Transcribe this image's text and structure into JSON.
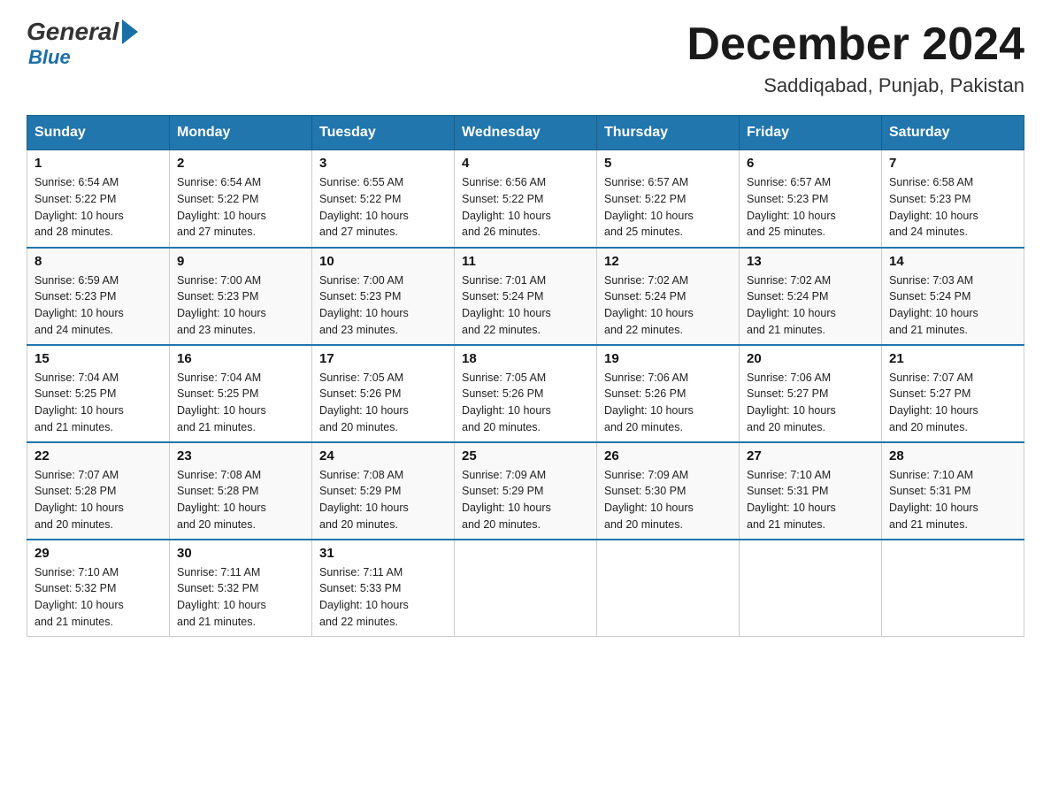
{
  "logo": {
    "general": "General",
    "blue": "Blue"
  },
  "title": "December 2024",
  "subtitle": "Saddiqabad, Punjab, Pakistan",
  "days_of_week": [
    "Sunday",
    "Monday",
    "Tuesday",
    "Wednesday",
    "Thursday",
    "Friday",
    "Saturday"
  ],
  "weeks": [
    [
      {
        "day": "1",
        "sunrise": "6:54 AM",
        "sunset": "5:22 PM",
        "daylight": "10 hours and 28 minutes."
      },
      {
        "day": "2",
        "sunrise": "6:54 AM",
        "sunset": "5:22 PM",
        "daylight": "10 hours and 27 minutes."
      },
      {
        "day": "3",
        "sunrise": "6:55 AM",
        "sunset": "5:22 PM",
        "daylight": "10 hours and 27 minutes."
      },
      {
        "day": "4",
        "sunrise": "6:56 AM",
        "sunset": "5:22 PM",
        "daylight": "10 hours and 26 minutes."
      },
      {
        "day": "5",
        "sunrise": "6:57 AM",
        "sunset": "5:22 PM",
        "daylight": "10 hours and 25 minutes."
      },
      {
        "day": "6",
        "sunrise": "6:57 AM",
        "sunset": "5:23 PM",
        "daylight": "10 hours and 25 minutes."
      },
      {
        "day": "7",
        "sunrise": "6:58 AM",
        "sunset": "5:23 PM",
        "daylight": "10 hours and 24 minutes."
      }
    ],
    [
      {
        "day": "8",
        "sunrise": "6:59 AM",
        "sunset": "5:23 PM",
        "daylight": "10 hours and 24 minutes."
      },
      {
        "day": "9",
        "sunrise": "7:00 AM",
        "sunset": "5:23 PM",
        "daylight": "10 hours and 23 minutes."
      },
      {
        "day": "10",
        "sunrise": "7:00 AM",
        "sunset": "5:23 PM",
        "daylight": "10 hours and 23 minutes."
      },
      {
        "day": "11",
        "sunrise": "7:01 AM",
        "sunset": "5:24 PM",
        "daylight": "10 hours and 22 minutes."
      },
      {
        "day": "12",
        "sunrise": "7:02 AM",
        "sunset": "5:24 PM",
        "daylight": "10 hours and 22 minutes."
      },
      {
        "day": "13",
        "sunrise": "7:02 AM",
        "sunset": "5:24 PM",
        "daylight": "10 hours and 21 minutes."
      },
      {
        "day": "14",
        "sunrise": "7:03 AM",
        "sunset": "5:24 PM",
        "daylight": "10 hours and 21 minutes."
      }
    ],
    [
      {
        "day": "15",
        "sunrise": "7:04 AM",
        "sunset": "5:25 PM",
        "daylight": "10 hours and 21 minutes."
      },
      {
        "day": "16",
        "sunrise": "7:04 AM",
        "sunset": "5:25 PM",
        "daylight": "10 hours and 21 minutes."
      },
      {
        "day": "17",
        "sunrise": "7:05 AM",
        "sunset": "5:26 PM",
        "daylight": "10 hours and 20 minutes."
      },
      {
        "day": "18",
        "sunrise": "7:05 AM",
        "sunset": "5:26 PM",
        "daylight": "10 hours and 20 minutes."
      },
      {
        "day": "19",
        "sunrise": "7:06 AM",
        "sunset": "5:26 PM",
        "daylight": "10 hours and 20 minutes."
      },
      {
        "day": "20",
        "sunrise": "7:06 AM",
        "sunset": "5:27 PM",
        "daylight": "10 hours and 20 minutes."
      },
      {
        "day": "21",
        "sunrise": "7:07 AM",
        "sunset": "5:27 PM",
        "daylight": "10 hours and 20 minutes."
      }
    ],
    [
      {
        "day": "22",
        "sunrise": "7:07 AM",
        "sunset": "5:28 PM",
        "daylight": "10 hours and 20 minutes."
      },
      {
        "day": "23",
        "sunrise": "7:08 AM",
        "sunset": "5:28 PM",
        "daylight": "10 hours and 20 minutes."
      },
      {
        "day": "24",
        "sunrise": "7:08 AM",
        "sunset": "5:29 PM",
        "daylight": "10 hours and 20 minutes."
      },
      {
        "day": "25",
        "sunrise": "7:09 AM",
        "sunset": "5:29 PM",
        "daylight": "10 hours and 20 minutes."
      },
      {
        "day": "26",
        "sunrise": "7:09 AM",
        "sunset": "5:30 PM",
        "daylight": "10 hours and 20 minutes."
      },
      {
        "day": "27",
        "sunrise": "7:10 AM",
        "sunset": "5:31 PM",
        "daylight": "10 hours and 21 minutes."
      },
      {
        "day": "28",
        "sunrise": "7:10 AM",
        "sunset": "5:31 PM",
        "daylight": "10 hours and 21 minutes."
      }
    ],
    [
      {
        "day": "29",
        "sunrise": "7:10 AM",
        "sunset": "5:32 PM",
        "daylight": "10 hours and 21 minutes."
      },
      {
        "day": "30",
        "sunrise": "7:11 AM",
        "sunset": "5:32 PM",
        "daylight": "10 hours and 21 minutes."
      },
      {
        "day": "31",
        "sunrise": "7:11 AM",
        "sunset": "5:33 PM",
        "daylight": "10 hours and 22 minutes."
      },
      null,
      null,
      null,
      null
    ]
  ],
  "labels": {
    "sunrise": "Sunrise:",
    "sunset": "Sunset:",
    "daylight": "Daylight:"
  }
}
